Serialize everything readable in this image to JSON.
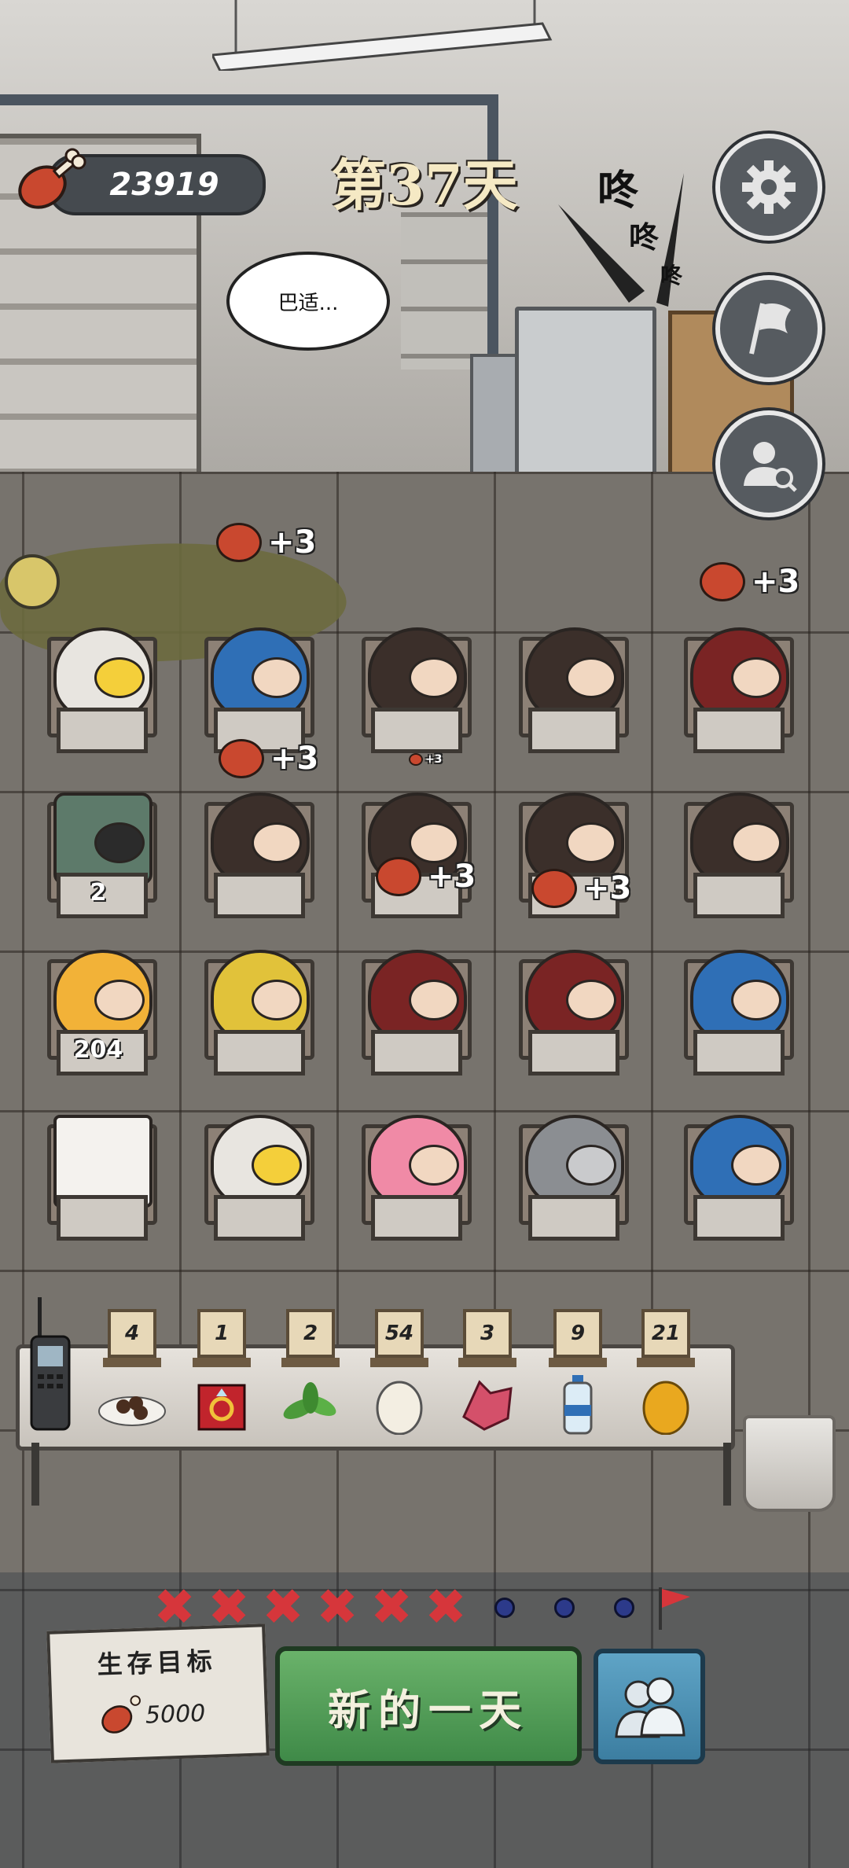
{
  "hud": {
    "food_count": "23919",
    "day_label": "第37天",
    "speech_bubble": "巴适...",
    "knock_sfx": [
      "咚",
      "咚",
      "咚"
    ]
  },
  "side_buttons": [
    {
      "icon": "gear-icon"
    },
    {
      "icon": "flag-icon"
    },
    {
      "icon": "profile-search-icon"
    }
  ],
  "floating_food": [
    {
      "text": "+3"
    },
    {
      "text": "+3"
    },
    {
      "text": "+3"
    },
    {
      "text": "+3"
    },
    {
      "text": "+3"
    },
    {
      "text": "+3"
    }
  ],
  "desk_numbers": {
    "robot": "2",
    "girl_headband": "204"
  },
  "inventory": [
    {
      "name": "beans",
      "count": "4"
    },
    {
      "name": "ring",
      "count": "1"
    },
    {
      "name": "herb",
      "count": "2"
    },
    {
      "name": "egg",
      "count": "54"
    },
    {
      "name": "crystal",
      "count": "3"
    },
    {
      "name": "water",
      "count": "9"
    },
    {
      "name": "golden-egg",
      "count": "21"
    }
  ],
  "progress": {
    "completed_marks": 6,
    "remaining_dots": 3
  },
  "goal": {
    "title": "生存目标",
    "value": "5000"
  },
  "buttons": {
    "new_day": "新的一天"
  },
  "colors": {
    "new_day_green": "#4f9a55",
    "team_blue": "#4a8db2",
    "x_red": "#d6363b",
    "dot_blue": "#2c3a8a"
  }
}
